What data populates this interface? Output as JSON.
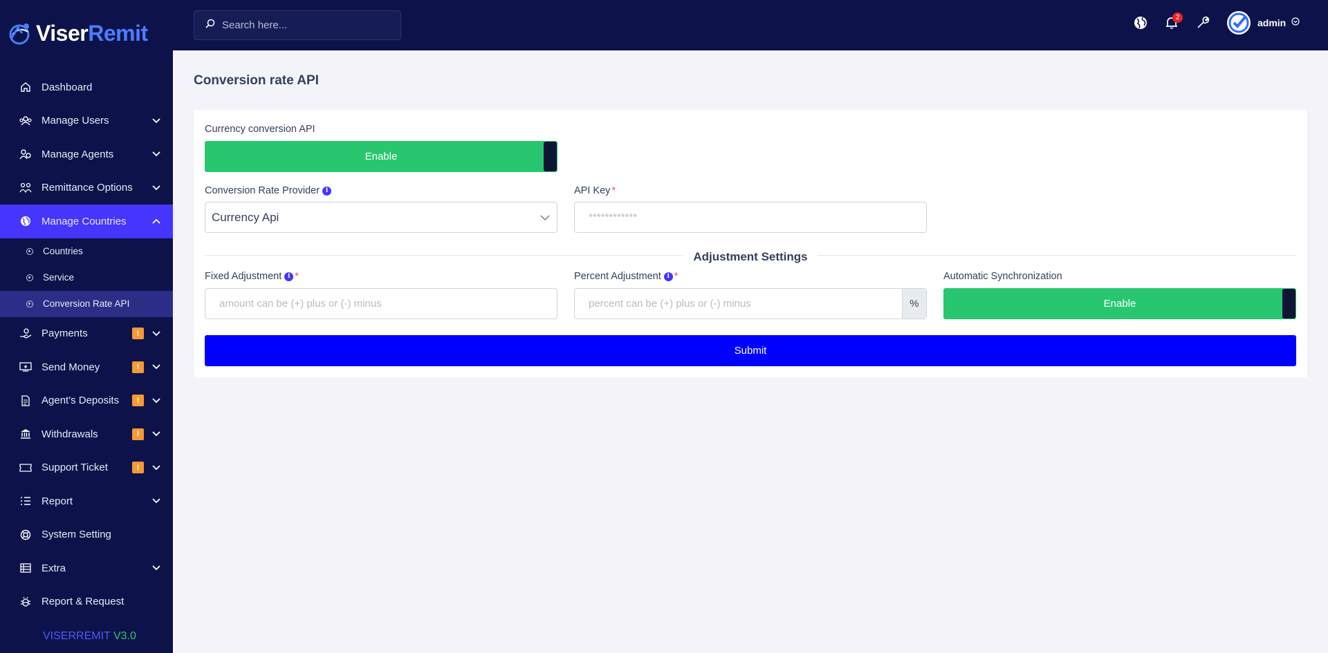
{
  "brand": {
    "name_part1": "Viser",
    "name_part2": "Remit"
  },
  "sidebar": {
    "items": [
      {
        "label": "Dashboard",
        "icon": "home-icon"
      },
      {
        "label": "Manage Users",
        "icon": "users-icon"
      },
      {
        "label": "Manage Agents",
        "icon": "agents-icon"
      },
      {
        "label": "Remittance Options",
        "icon": "remittance-icon"
      },
      {
        "label": "Manage Countries",
        "icon": "globe-icon"
      }
    ],
    "sub_items": [
      {
        "label": "Countries"
      },
      {
        "label": "Service"
      },
      {
        "label": "Conversion Rate API"
      }
    ],
    "items_after": [
      {
        "label": "Payments",
        "badge": "!"
      },
      {
        "label": "Send Money",
        "badge": "!"
      },
      {
        "label": "Agent's Deposits",
        "badge": "!"
      },
      {
        "label": "Withdrawals",
        "badge": "!"
      },
      {
        "label": "Support Ticket",
        "badge": "!"
      },
      {
        "label": "Report"
      },
      {
        "label": "System Setting"
      },
      {
        "label": "Extra"
      },
      {
        "label": "Report & Request"
      }
    ],
    "version_name": "VISERREMIT",
    "version_number": "V3.0"
  },
  "topbar": {
    "search_placeholder": "Search here...",
    "notification_count": "2",
    "username": "admin"
  },
  "page": {
    "title": "Conversion rate API",
    "currency_api_label": "Currency conversion API",
    "currency_api_toggle": "Enable",
    "provider_label": "Conversion Rate Provider",
    "provider_value": "Currency Api",
    "api_key_label": "API Key",
    "api_key_placeholder": "************",
    "section_title": "Adjustment Settings",
    "fixed_label": "Fixed Adjustment",
    "fixed_placeholder": "amount can be (+) plus or (-) minus",
    "percent_label": "Percent Adjustment",
    "percent_placeholder": "percent can be (+) plus or (-) minus",
    "percent_addon": "%",
    "auto_sync_label": "Automatic Synchronization",
    "auto_sync_toggle": "Enable",
    "submit_label": "Submit",
    "required_mark": "*",
    "info_mark": "i"
  },
  "colors": {
    "sidebar_bg": "#0d134a",
    "active": "#4634ff",
    "success": "#28c76f",
    "submit": "#0000ff",
    "warning_badge": "#f79a33"
  }
}
